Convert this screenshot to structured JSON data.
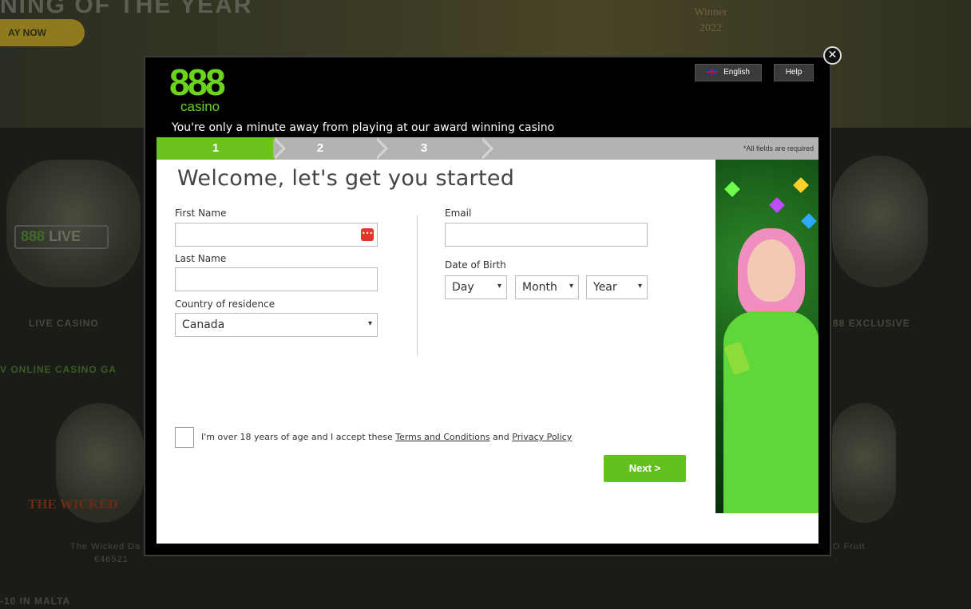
{
  "background": {
    "title": "NING OF THE YEAR",
    "play_button": "AY NOW",
    "badge_text": "Winner\n2022",
    "live_888": "888",
    "live_label": "LIVE",
    "tiles": {
      "live_casino": "LIVE CASINO",
      "exclusive": "88 EXCLUSIVE",
      "section_games": "V ONLINE CASINO GA",
      "wicked_logo": "THE WICKED",
      "wicked_title": "The Wicked Da",
      "wicked_jackpot": "€46521",
      "fruit_title": "O Fruit",
      "section_malta": "-10 IN MALTA"
    }
  },
  "modal": {
    "logo_main": "888",
    "logo_sub": "casino",
    "language_button": "English",
    "help_button": "Help",
    "close_symbol": "✕",
    "tagline": "You're only a minute away from playing at our award winning casino",
    "steps": [
      "1",
      "2",
      "3"
    ],
    "active_step": 1,
    "required_note": "*All fields are required",
    "accent_color": "#6cc31e",
    "form": {
      "heading": "Welcome, let's get you started",
      "first_name_label": "First Name",
      "first_name_value": "",
      "last_name_label": "Last Name",
      "last_name_value": "",
      "country_label": "Country of residence",
      "country_value": "Canada",
      "email_label": "Email",
      "email_value": "",
      "dob_label": "Date of Birth",
      "dob_day": "Day",
      "dob_month": "Month",
      "dob_year": "Year",
      "consent_prefix": "I'm over 18 years of age and I accept these ",
      "terms_link": "Terms and Conditions",
      "consent_and": " and ",
      "privacy_link": "Privacy Policy",
      "next_button": "Next >"
    },
    "icons": {
      "close": "close-icon",
      "flag": "uk-flag-icon",
      "password_manager": "password-manager-icon",
      "dropdown": "chevron-down-icon"
    }
  }
}
